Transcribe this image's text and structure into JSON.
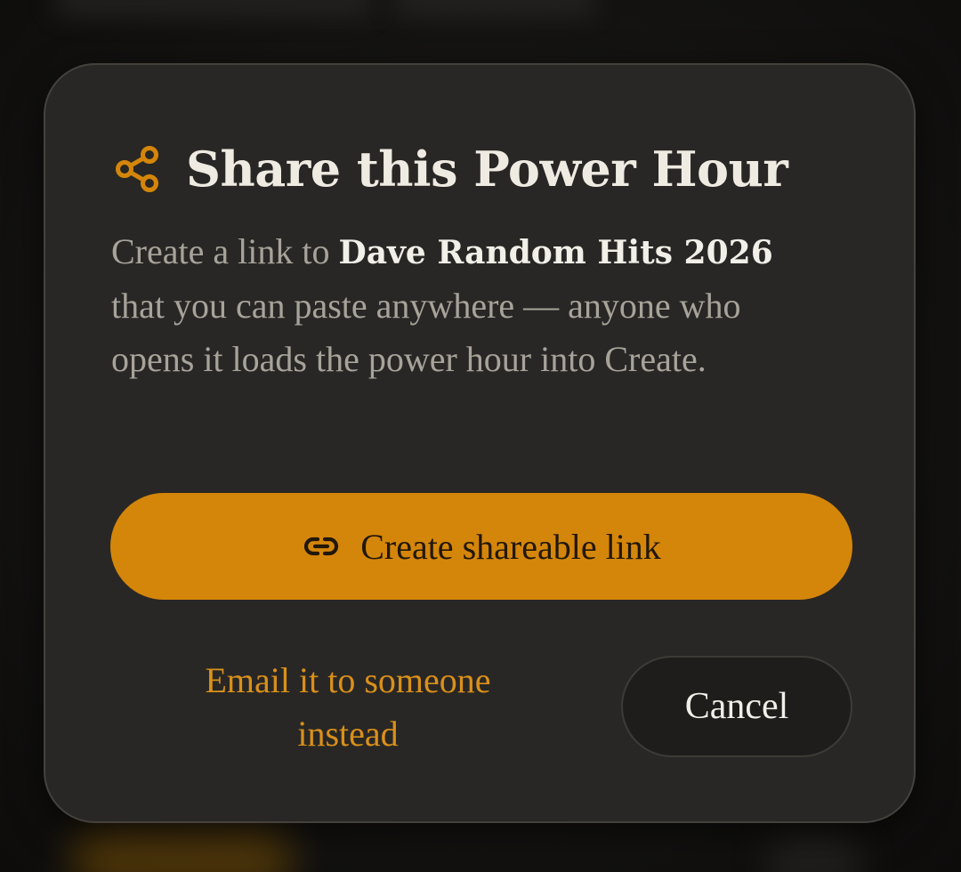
{
  "dialog": {
    "title": "Share this Power Hour",
    "icon": "share-icon",
    "description": {
      "before": "Create a link to ",
      "highlight": "Dave Random Hits 2026",
      "after": " that you can paste anywhere — anyone who opens it loads the power hour into Create."
    },
    "primary_button": {
      "icon": "link-icon",
      "label": "Create shareable link"
    },
    "email_link": "Email it to someone instead",
    "cancel_label": "Cancel"
  },
  "colors": {
    "accent": "#d4860a",
    "accent_text": "#d9901a",
    "dialog_bg": "#292725",
    "title_text": "#efebe2",
    "body_text": "#a8a39a"
  }
}
